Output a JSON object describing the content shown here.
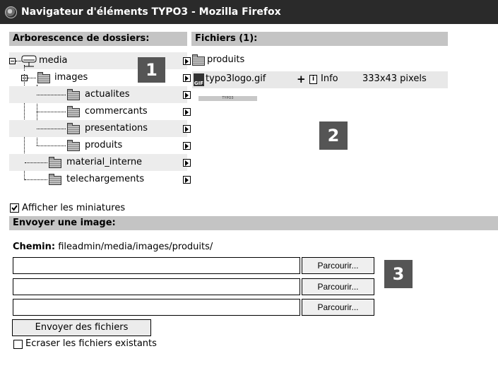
{
  "window": {
    "title": "Navigateur d'éléments TYPO3 - Mozilla Firefox",
    "icon": "firefox-icon"
  },
  "tree": {
    "header": "Arborescence de dossiers:",
    "items": [
      {
        "label": "media",
        "icon": "drive-icon"
      },
      {
        "label": "images",
        "icon": "folder-icon"
      },
      {
        "label": "actualites",
        "icon": "folder-icon"
      },
      {
        "label": "commercants",
        "icon": "folder-icon"
      },
      {
        "label": "presentations",
        "icon": "folder-icon"
      },
      {
        "label": "produits",
        "icon": "folder-icon"
      },
      {
        "label": "material_interne",
        "icon": "folder-icon"
      },
      {
        "label": "telechargements",
        "icon": "folder-icon"
      }
    ]
  },
  "files": {
    "header": "Fichiers (1):",
    "folder": "produits",
    "file": {
      "name": "typo3logo.gif",
      "type_badge": "GIF",
      "plus": "+",
      "info_icon": "i",
      "info": "Info",
      "dimensions": "333x43 pixels",
      "thumb_text": "TYPO3"
    }
  },
  "badges": {
    "one": "1",
    "two": "2",
    "three": "3"
  },
  "thumbnails": {
    "label": "Afficher les miniatures",
    "checked": true
  },
  "upload": {
    "header": "Envoyer une image:",
    "path_label": "Chemin:",
    "path": "fileadmin/media/images/produits/",
    "browse": "Parcourir...",
    "submit": "Envoyer des fichiers",
    "overwrite_label": "Ecraser les fichiers existants",
    "overwrite_checked": false
  },
  "colors": {
    "titlebar": "#2a2a2a",
    "header": "#c4c4c4",
    "badge": "#555555"
  }
}
